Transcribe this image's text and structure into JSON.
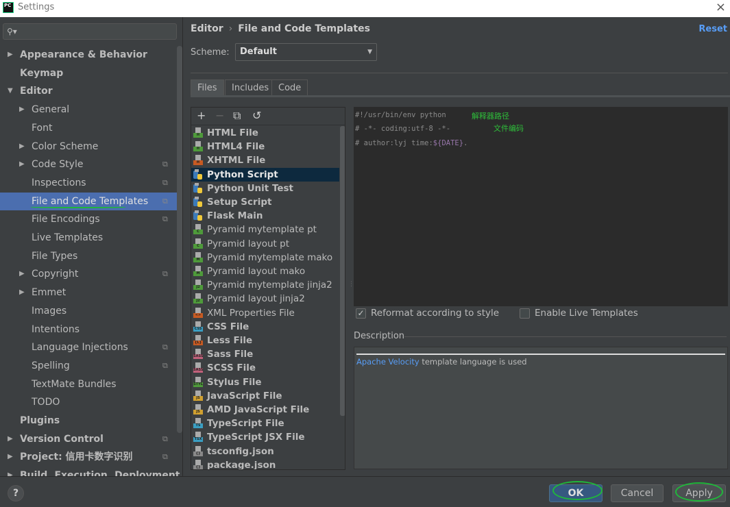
{
  "window": {
    "title": "Settings",
    "logo": "PC",
    "close": "×"
  },
  "search": {
    "placeholder": "",
    "icon": "search-icon"
  },
  "sidebar": {
    "items": [
      {
        "label": "Appearance & Behavior",
        "level": 0,
        "arrow": "right",
        "bold": true
      },
      {
        "label": "Keymap",
        "level": 0,
        "bold": true
      },
      {
        "label": "Editor",
        "level": 0,
        "arrow": "down",
        "bold": true
      },
      {
        "label": "General",
        "level": 1,
        "arrow": "right"
      },
      {
        "label": "Font",
        "level": 1
      },
      {
        "label": "Color Scheme",
        "level": 1,
        "arrow": "right"
      },
      {
        "label": "Code Style",
        "level": 1,
        "arrow": "right",
        "copy": true
      },
      {
        "label": "Inspections",
        "level": 1,
        "copy": true
      },
      {
        "label": "File and Code Templates",
        "level": 1,
        "copy": true,
        "selected": true
      },
      {
        "label": "File Encodings",
        "level": 1,
        "copy": true
      },
      {
        "label": "Live Templates",
        "level": 1
      },
      {
        "label": "File Types",
        "level": 1
      },
      {
        "label": "Copyright",
        "level": 1,
        "arrow": "right",
        "copy": true
      },
      {
        "label": "Emmet",
        "level": 1,
        "arrow": "right"
      },
      {
        "label": "Images",
        "level": 1
      },
      {
        "label": "Intentions",
        "level": 1
      },
      {
        "label": "Language Injections",
        "level": 1,
        "copy": true
      },
      {
        "label": "Spelling",
        "level": 1,
        "copy": true
      },
      {
        "label": "TextMate Bundles",
        "level": 1
      },
      {
        "label": "TODO",
        "level": 1
      },
      {
        "label": "Plugins",
        "level": 0,
        "bold": true
      },
      {
        "label": "Version Control",
        "level": 0,
        "arrow": "right",
        "bold": true,
        "copy": true
      },
      {
        "label": "Project: 信用卡数字识别",
        "level": 0,
        "arrow": "right",
        "bold": true,
        "copy": true
      },
      {
        "label": "Build, Execution, Deployment",
        "level": 0,
        "arrow": "right",
        "bold": true
      }
    ]
  },
  "header": {
    "breadcrumb": [
      "Editor",
      "File and Code Templates"
    ],
    "separator": "›",
    "reset": "Reset"
  },
  "scheme": {
    "label": "Scheme:",
    "value": "Default"
  },
  "tabs": [
    {
      "label": "Files",
      "selected": true
    },
    {
      "label": "Includes"
    },
    {
      "label": "Code"
    }
  ],
  "toolbar": {
    "add": "+",
    "remove": "−",
    "copy": "⧉",
    "revert": "↺"
  },
  "templates": [
    {
      "label": "HTML File",
      "bold": true,
      "badge": "H",
      "color": "#4e9a3a"
    },
    {
      "label": "HTML4 File",
      "bold": true,
      "badge": "H",
      "color": "#4e9a3a"
    },
    {
      "label": "XHTML File",
      "bold": true,
      "badge": "H",
      "color": "#c75a22"
    },
    {
      "label": "Python Script",
      "bold": true,
      "badge": "py",
      "color": "#3c7ab8",
      "selected": true
    },
    {
      "label": "Python Unit Test",
      "bold": true,
      "badge": "py",
      "color": "#3c7ab8"
    },
    {
      "label": "Setup Script",
      "bold": true,
      "badge": "py",
      "color": "#3c7ab8"
    },
    {
      "label": "Flask Main",
      "bold": true,
      "badge": "py",
      "color": "#3c7ab8"
    },
    {
      "label": "Pyramid mytemplate pt",
      "badge": "C",
      "color": "#4e9a3a"
    },
    {
      "label": "Pyramid layout pt",
      "badge": "C",
      "color": "#4e9a3a"
    },
    {
      "label": "Pyramid mytemplate mako",
      "badge": "M",
      "color": "#4e9a3a"
    },
    {
      "label": "Pyramid layout mako",
      "badge": "M",
      "color": "#4e9a3a"
    },
    {
      "label": "Pyramid mytemplate jinja2",
      "badge": "J2",
      "color": "#4e9a3a"
    },
    {
      "label": "Pyramid layout jinja2",
      "badge": "J2",
      "color": "#4e9a3a"
    },
    {
      "label": "XML Properties File",
      "badge": "<>",
      "color": "#c75a22"
    },
    {
      "label": "CSS File",
      "bold": true,
      "badge": "CSS",
      "color": "#3a9ec2"
    },
    {
      "label": "Less File",
      "bold": true,
      "badge": "{L}",
      "color": "#c75a22"
    },
    {
      "label": "Sass File",
      "bold": true,
      "badge": "SASS",
      "color": "#c0607a"
    },
    {
      "label": "SCSS File",
      "bold": true,
      "badge": "SASS",
      "color": "#c0607a"
    },
    {
      "label": "Stylus File",
      "bold": true,
      "badge": "STYL",
      "color": "#4e9a3a"
    },
    {
      "label": "JavaScript File",
      "bold": true,
      "badge": "JS",
      "color": "#d0a030"
    },
    {
      "label": "AMD JavaScript File",
      "bold": true,
      "badge": "JS",
      "color": "#d0a030"
    },
    {
      "label": "TypeScript File",
      "bold": true,
      "badge": "TS",
      "color": "#3a9ec2"
    },
    {
      "label": "TypeScript JSX File",
      "bold": true,
      "badge": "TSX",
      "color": "#3a9ec2"
    },
    {
      "label": "tsconfig.json",
      "bold": true,
      "badge": "{}",
      "color": "#888888"
    },
    {
      "label": "package.json",
      "bold": true,
      "badge": "{}",
      "color": "#888888"
    }
  ],
  "editor": {
    "lines": [
      "#!/usr/bin/env python",
      "# -*- coding:utf-8 -*-",
      "# author:lyj time:"
    ],
    "variable": "${DATE}",
    "trailing": ".",
    "notes": [
      "解释器路径",
      "文件编码"
    ]
  },
  "options": {
    "reformat": {
      "label": "Reformat according to style",
      "checked": true
    },
    "live_templates": {
      "label": "Enable Live Templates",
      "checked": false
    }
  },
  "description": {
    "label": "Description",
    "link": "Apache Velocity",
    "text": " template language is used"
  },
  "footer": {
    "help": "?",
    "ok": "OK",
    "cancel": "Cancel",
    "apply": "Apply"
  },
  "colors": {
    "accent": "#4b6eaf",
    "link": "#589df6",
    "annotation": "#2ebd3a"
  }
}
